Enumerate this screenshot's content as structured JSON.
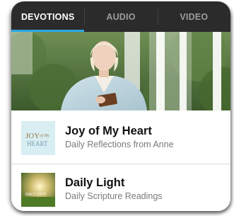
{
  "tabs": [
    {
      "label": "DEVOTIONS",
      "active": true
    },
    {
      "label": "AUDIO",
      "active": false
    },
    {
      "label": "VIDEO",
      "active": false
    }
  ],
  "colors": {
    "tab_bar": "#2b2b2b",
    "active_indicator": "#2aa7e6",
    "tab_active_text": "#ffffff",
    "tab_inactive_text": "#9c9c9c"
  },
  "devotions": [
    {
      "title": "Joy of My Heart",
      "subtitle": "Daily Reflections from Anne",
      "thumb_text": [
        "JOY",
        "of My",
        "HEART"
      ]
    },
    {
      "title": "Daily Light",
      "subtitle": "Daily Scripture Readings",
      "thumb_text": "DAILY LIGHT"
    }
  ]
}
